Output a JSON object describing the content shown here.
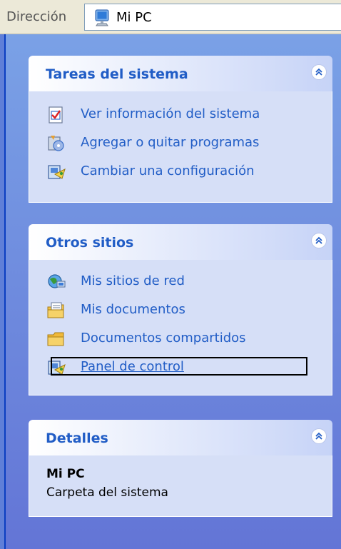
{
  "address": {
    "label": "Dirección",
    "value": "Mi PC"
  },
  "panels": {
    "system_tasks": {
      "title": "Tareas del sistema",
      "items": [
        {
          "label": "Ver información del sistema",
          "icon": "system-info-icon"
        },
        {
          "label": "Agregar o quitar programas",
          "icon": "add-remove-programs-icon"
        },
        {
          "label": "Cambiar una configuración",
          "icon": "control-panel-icon"
        }
      ]
    },
    "other_places": {
      "title": "Otros sitios",
      "items": [
        {
          "label": "Mis sitios de red",
          "icon": "network-places-icon"
        },
        {
          "label": "Mis documentos",
          "icon": "my-documents-icon"
        },
        {
          "label": "Documentos compartidos",
          "icon": "folder-icon"
        },
        {
          "label": "Panel de control",
          "icon": "control-panel-icon",
          "focused": true
        }
      ]
    },
    "details": {
      "title": "Detalles",
      "name": "Mi PC",
      "description": "Carpeta del sistema"
    }
  },
  "colors": {
    "link": "#215dc6",
    "pane_top": "#7aa1e6",
    "pane_bottom": "#6375d6",
    "panel_body": "#d6dff7"
  }
}
